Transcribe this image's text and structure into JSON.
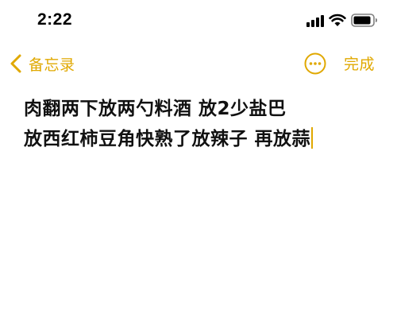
{
  "status_bar": {
    "time": "2:22",
    "icons": [
      "signal-icon",
      "wifi-icon",
      "battery-icon"
    ]
  },
  "nav": {
    "back_label": "备忘录",
    "done_label": "完成",
    "icons": [
      "chevron-left-icon",
      "more-icon"
    ]
  },
  "note": {
    "lines": [
      "肉翻两下放两勺料酒  放2少盐巴",
      "放西红柿豆角快熟了放辣子 再放蒜"
    ]
  },
  "colors": {
    "accent": "#e0a800",
    "text": "#111111",
    "background": "#ffffff"
  }
}
